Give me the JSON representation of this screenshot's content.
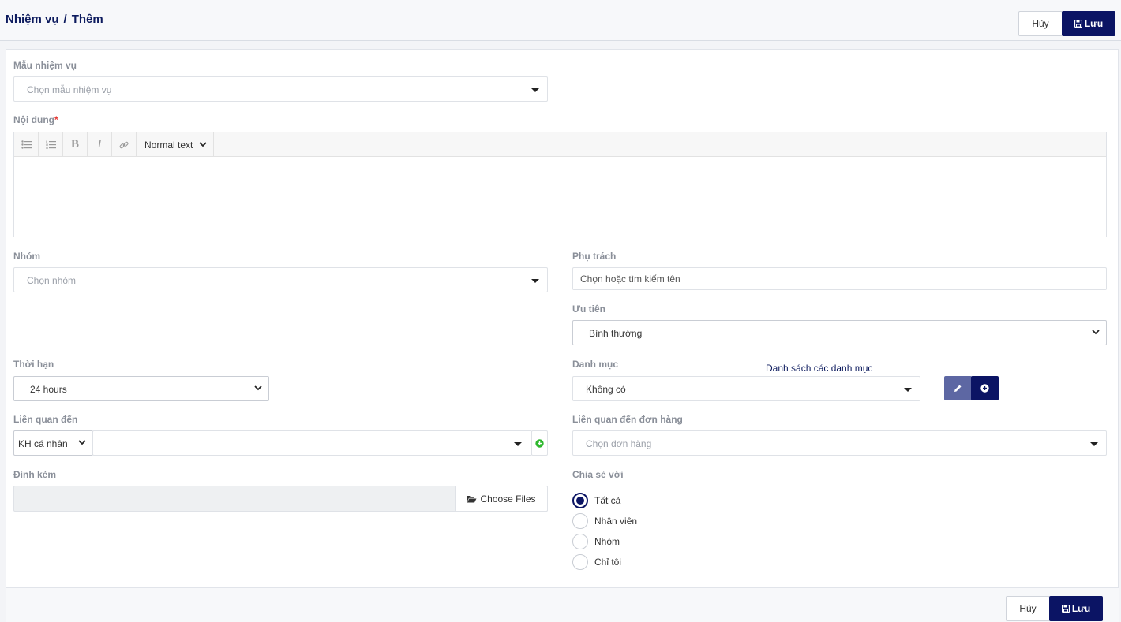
{
  "header": {
    "breadcrumb_parent": "Nhiệm vụ",
    "breadcrumb_sep": "/",
    "breadcrumb_current": "Thêm",
    "cancel_label": "Hủy",
    "save_label": "Lưu"
  },
  "form": {
    "template": {
      "label": "Mẫu nhiệm vụ",
      "placeholder": "Chọn mẫu nhiệm vụ"
    },
    "content": {
      "label": "Nội dung",
      "required_mark": "*",
      "text_style": "Normal text"
    },
    "group": {
      "label": "Nhóm",
      "placeholder": "Chọn nhóm"
    },
    "assignee": {
      "label": "Phụ trách",
      "placeholder": "Chọn hoặc tìm kiếm tên"
    },
    "priority": {
      "label": "Ưu tiên",
      "value": "Bình thường"
    },
    "deadline": {
      "label": "Thời hạn",
      "value": "24 hours"
    },
    "category": {
      "label": "Danh mục",
      "value": "Không có",
      "list_link": "Danh sách các danh mục"
    },
    "related_to": {
      "label": "Liên quan đến",
      "type_value": "KH cá nhân"
    },
    "related_order": {
      "label": "Liên quan đến đơn hàng",
      "placeholder": "Chọn đơn hàng"
    },
    "attachment": {
      "label": "Đính kèm",
      "button_label": "Choose Files"
    },
    "share": {
      "label": "Chia sẻ với",
      "options": [
        "Tất cả",
        "Nhân viên",
        "Nhóm",
        "Chỉ tôi"
      ],
      "selected": "Tất cả"
    }
  },
  "footer": {
    "cancel_label": "Hủy",
    "save_label": "Lưu"
  },
  "colors": {
    "primary": "#0b1464",
    "edit_button": "#5d67a3",
    "add_green": "#2eb82e"
  }
}
